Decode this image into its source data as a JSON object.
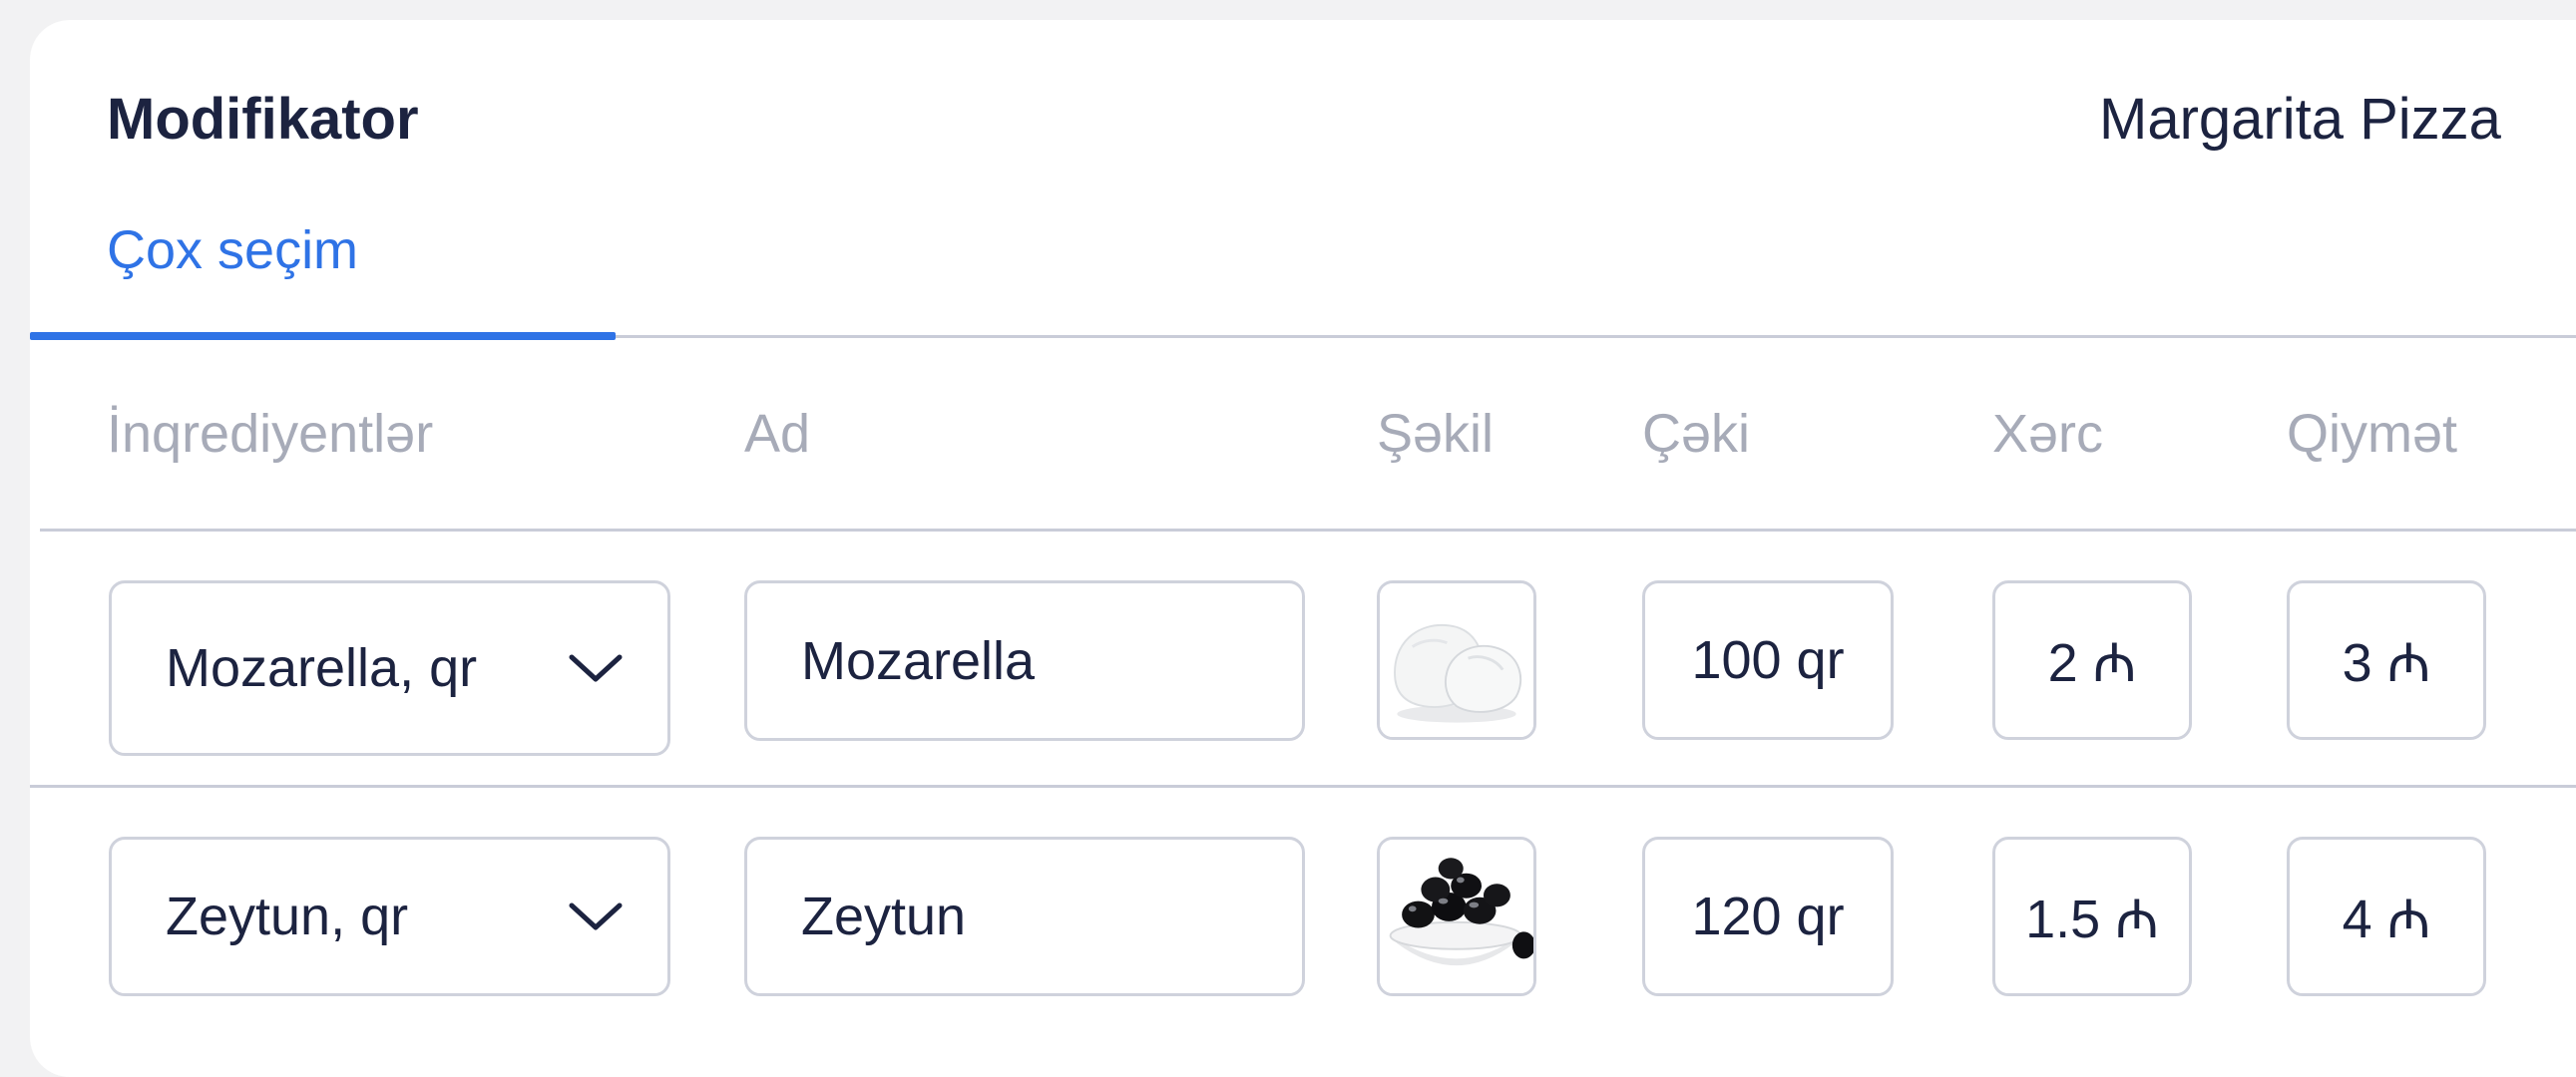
{
  "header": {
    "title": "Modifikator",
    "product": "Margarita Pizza"
  },
  "tabs": [
    {
      "label": "Çox seçim",
      "active": true
    }
  ],
  "columns": {
    "ingredients": "İnqrediyentlər",
    "name": "Ad",
    "image": "Şəkil",
    "weight": "Çəki",
    "cost": "Xərc",
    "price": "Qiymət"
  },
  "rows": [
    {
      "ingredient": "Mozarella, qr",
      "name": "Mozarella",
      "image_icon": "mozzarella-image",
      "weight": "100 qr",
      "cost": "2 ₼",
      "price": "3 ₼"
    },
    {
      "ingredient": "Zeytun, qr",
      "name": "Zeytun",
      "image_icon": "olives-image",
      "weight": "120 qr",
      "cost": "1.5 ₼",
      "price": "4 ₼"
    }
  ],
  "colors": {
    "accent": "#2f73e6",
    "text": "#1c2340",
    "muted": "#a7abb8",
    "border": "#cfd2dc"
  }
}
